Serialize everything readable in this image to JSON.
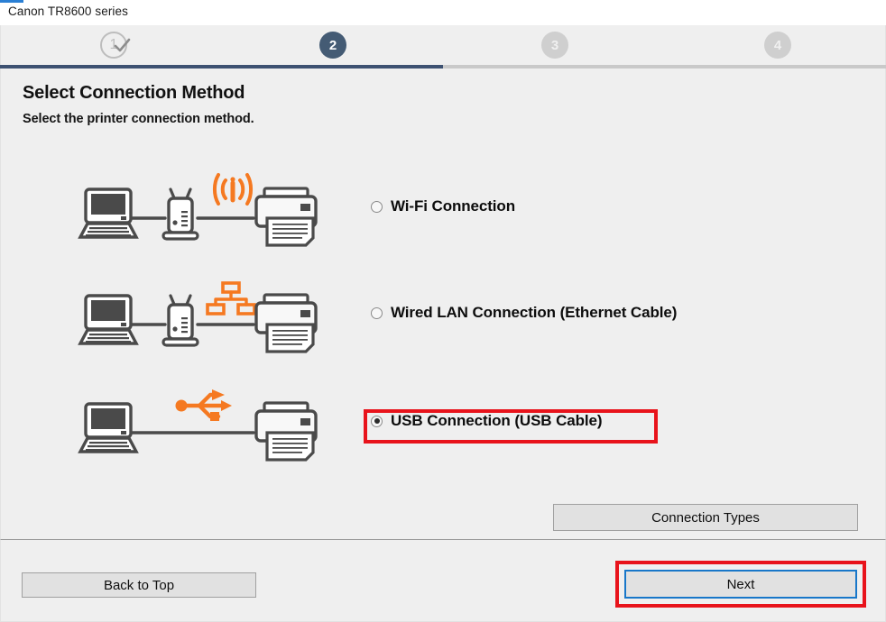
{
  "window": {
    "title": "Canon TR8600 series"
  },
  "stepper": {
    "steps": [
      {
        "number": "1",
        "state": "completed",
        "icon": "check-icon"
      },
      {
        "number": "2",
        "state": "current",
        "icon": ""
      },
      {
        "number": "3",
        "state": "upcoming",
        "icon": ""
      },
      {
        "number": "4",
        "state": "upcoming",
        "icon": ""
      }
    ],
    "progress_percent": 50,
    "fill_color": "#3d5171",
    "track_color": "#c9c9c9",
    "current_color": "#445b74"
  },
  "page": {
    "title": "Select Connection Method",
    "subtitle": "Select the printer connection method."
  },
  "options": [
    {
      "id": "wifi",
      "label": "Wi-Fi Connection",
      "selected": false,
      "art": "laptop-router-wifi-printer",
      "accent_icon": "wifi-signal-icon",
      "accent_color": "#f57921"
    },
    {
      "id": "wired-lan",
      "label": "Wired LAN Connection (Ethernet Cable)",
      "selected": false,
      "art": "laptop-router-lan-printer",
      "accent_icon": "network-topology-icon",
      "accent_color": "#f57921"
    },
    {
      "id": "usb",
      "label": "USB Connection (USB Cable)",
      "selected": true,
      "art": "laptop-usb-printer",
      "accent_icon": "usb-icon",
      "accent_color": "#f57921"
    }
  ],
  "buttons": {
    "connection_types": "Connection Types",
    "back_to_top": "Back to Top",
    "next": "Next"
  },
  "annotations": {
    "highlight_color": "#e8131b",
    "focus_color": "#1877c9",
    "highlighted": [
      "usb-option",
      "next-button"
    ]
  }
}
